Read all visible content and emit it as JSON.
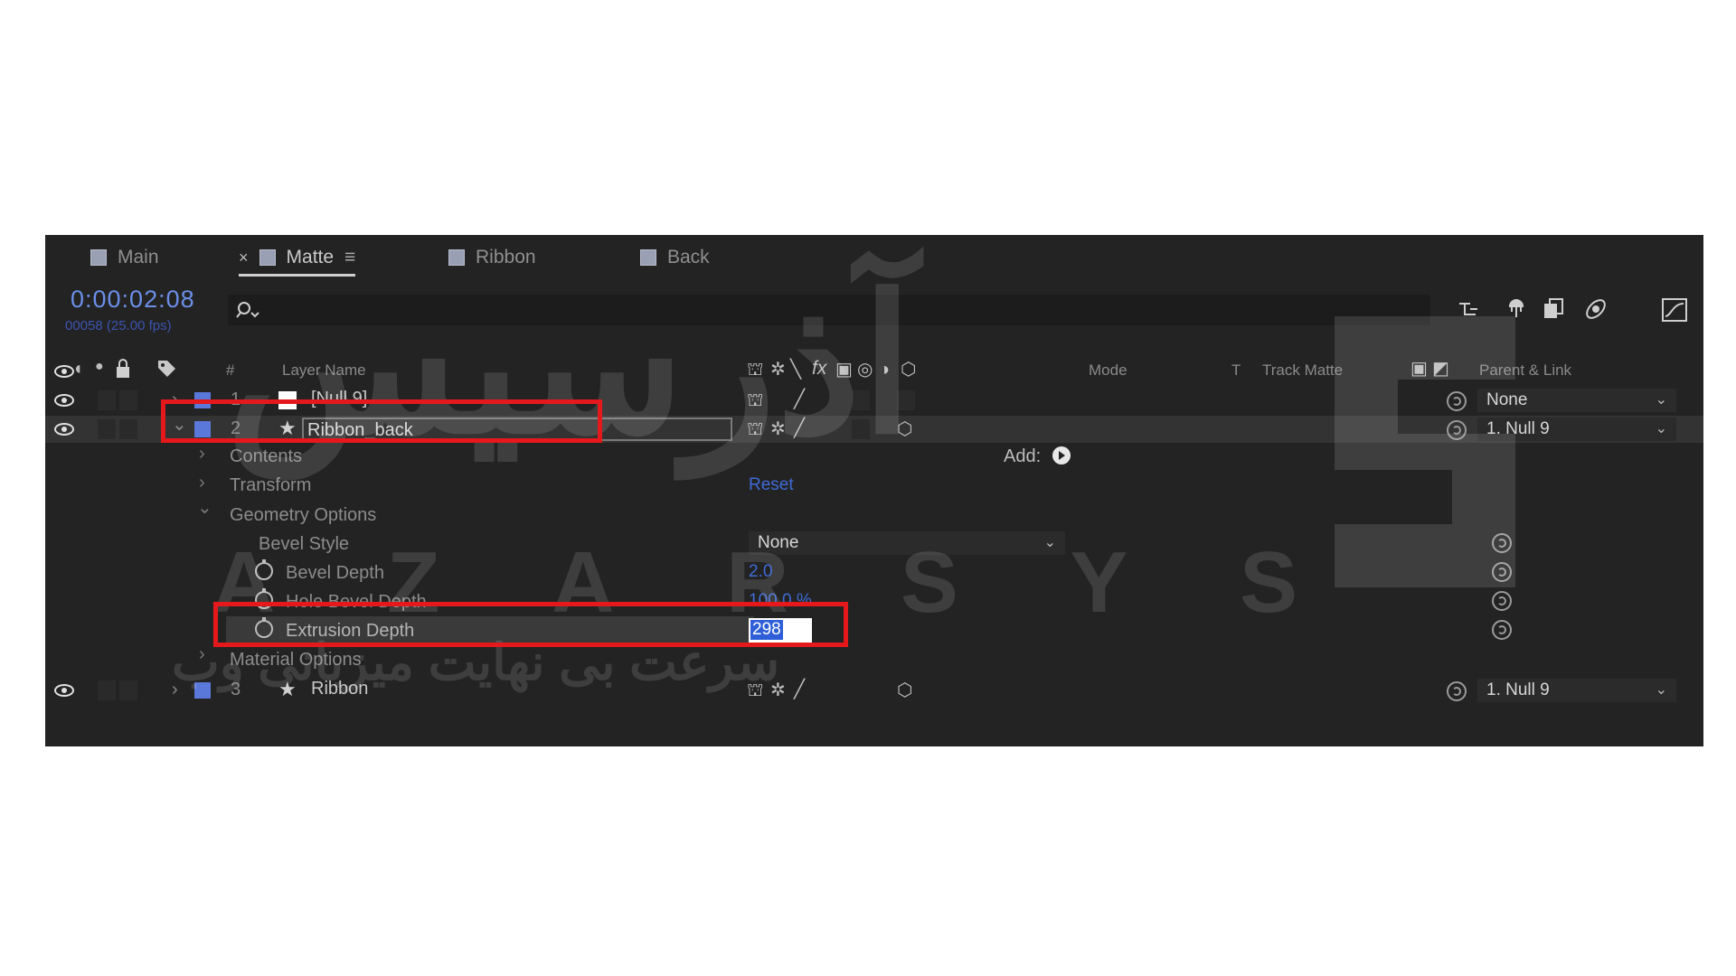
{
  "tabs": [
    {
      "label": "Main"
    },
    {
      "label": "Matte",
      "close": "×",
      "menu": "≡"
    },
    {
      "label": "Ribbon"
    },
    {
      "label": "Back"
    }
  ],
  "timecode": "0:00:02:08",
  "frame_info": "00058 (25.00 fps)",
  "columns": {
    "num": "#",
    "layer_name": "Layer Name",
    "mode": "Mode",
    "t": "T",
    "track_matte": "Track Matte",
    "parent_link": "Parent & Link",
    "fx": "fx"
  },
  "layers": [
    {
      "index": "1",
      "name": "[Null 9]",
      "parent": "None"
    },
    {
      "index": "2",
      "name": "Ribbon_back",
      "parent": "1. Null 9"
    },
    {
      "index": "3",
      "name": "Ribbon",
      "parent": "1. Null 9"
    }
  ],
  "properties": {
    "contents": "Contents",
    "add_label": "Add:",
    "transform": "Transform",
    "reset": "Reset",
    "geometry_options": "Geometry Options",
    "bevel_style": "Bevel Style",
    "bevel_style_value": "None",
    "bevel_depth": "Bevel Depth",
    "bevel_depth_value": "2.0",
    "hole_bevel_depth": "Hole Bevel Depth",
    "hole_bevel_depth_value": "100.0 %",
    "extrusion_depth": "Extrusion Depth",
    "extrusion_depth_value": "298",
    "material_options": "Material Options"
  },
  "watermark": {
    "brand": "AZARSYS",
    "letters": [
      "A",
      "Z",
      "A",
      "R",
      "S",
      "Y",
      "S"
    ],
    "persian_title": "آذرسیس",
    "persian_tagline": "سرعت بی نهایت میزبانی وب"
  },
  "colors": {
    "highlight": "#e5191c",
    "timecode": "#6b8fe8",
    "label_blue": "#5a78d9",
    "panel_bg": "#232323"
  }
}
